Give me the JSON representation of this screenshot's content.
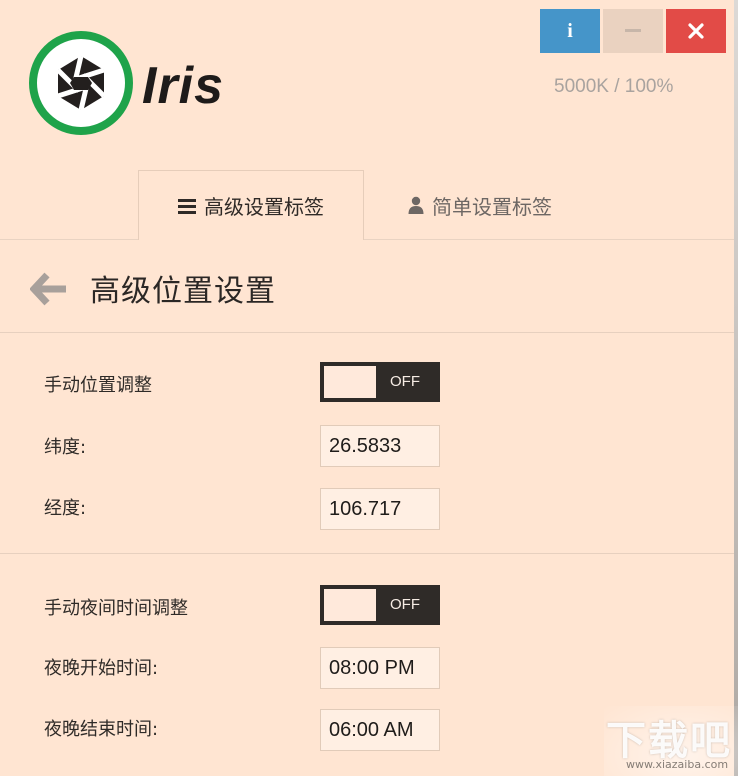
{
  "header": {
    "brand": "Iris",
    "status": "5000K / 100%",
    "buttons": {
      "info": "i"
    }
  },
  "tabs": [
    {
      "label": "高级设置标签",
      "icon": "hamburger-icon",
      "active": true
    },
    {
      "label": "简单设置标签",
      "icon": "user-icon",
      "active": false
    }
  ],
  "page": {
    "title": "高级位置设置"
  },
  "location": {
    "manual_label": "手动位置调整",
    "manual_state": "OFF",
    "lat_label": "纬度:",
    "lat_value": "26.5833",
    "lng_label": "经度:",
    "lng_value": "106.717"
  },
  "night": {
    "manual_label": "手动夜间时间调整",
    "manual_state": "OFF",
    "start_label": "夜晚开始时间:",
    "start_value": "08:00 PM",
    "end_label": "夜晚结束时间:",
    "end_value": "06:00 AM"
  },
  "watermark": {
    "text": "下载吧",
    "url": "www.xiazaiba.com"
  },
  "colors": {
    "background": "#ffe5d2",
    "info_button": "#4595c9",
    "minimize_button": "#ead2c0",
    "close_button": "#e24b47",
    "logo_ring": "#1fa34a",
    "toggle": "#2f2b28"
  }
}
